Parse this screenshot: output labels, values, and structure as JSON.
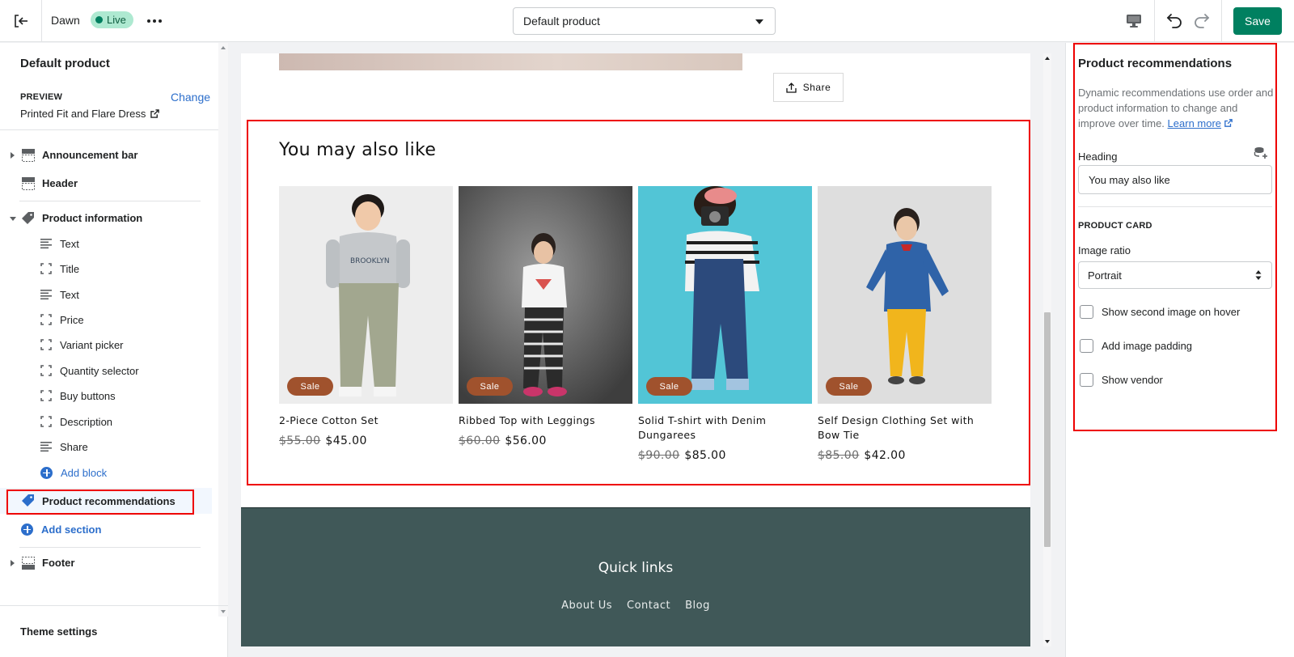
{
  "topbar": {
    "theme_name": "Dawn",
    "live_badge": "Live",
    "template_select": "Default product",
    "save_label": "Save"
  },
  "sidebar": {
    "title": "Default product",
    "preview_label": "PREVIEW",
    "change_link": "Change",
    "preview_product": "Printed Fit and Flare Dress",
    "sections_top": [
      {
        "label": "Announcement bar",
        "icon": "section-icon"
      },
      {
        "label": "Header",
        "icon": "section-icon"
      }
    ],
    "product_information": {
      "label": "Product information",
      "icon": "tag-icon",
      "blocks": [
        {
          "label": "Text",
          "icon": "text-lines-icon"
        },
        {
          "label": "Title",
          "icon": "block-corners-icon"
        },
        {
          "label": "Text",
          "icon": "text-lines-icon"
        },
        {
          "label": "Price",
          "icon": "block-corners-icon"
        },
        {
          "label": "Variant picker",
          "icon": "block-corners-icon"
        },
        {
          "label": "Quantity selector",
          "icon": "block-corners-icon"
        },
        {
          "label": "Buy buttons",
          "icon": "block-corners-icon"
        },
        {
          "label": "Description",
          "icon": "block-corners-icon"
        },
        {
          "label": "Share",
          "icon": "text-lines-icon"
        }
      ],
      "add_block": "Add block"
    },
    "product_recommendations": "Product recommendations",
    "add_section": "Add section",
    "footer": "Footer",
    "theme_settings": "Theme settings"
  },
  "preview": {
    "share_label": "Share",
    "heading": "You may also like",
    "products": [
      {
        "title": "2-Piece Cotton Set",
        "old_price": "$55.00",
        "price": "$45.00",
        "badge": "Sale"
      },
      {
        "title": "Ribbed Top with Leggings",
        "old_price": "$60.00",
        "price": "$56.00",
        "badge": "Sale"
      },
      {
        "title": "Solid T-shirt with Denim Dungarees",
        "old_price": "$90.00",
        "price": "$85.00",
        "badge": "Sale"
      },
      {
        "title": "Self Design Clothing Set with Bow Tie",
        "old_price": "$85.00",
        "price": "$42.00",
        "badge": "Sale"
      }
    ],
    "footer_heading": "Quick links",
    "footer_links": [
      "About Us",
      "Contact",
      "Blog"
    ]
  },
  "settings": {
    "title": "Product recommendations",
    "description": "Dynamic recommendations use order and product information to change and improve over time.",
    "learn_more": "Learn more",
    "heading_label": "Heading",
    "heading_value": "You may also like",
    "product_card_label": "PRODUCT CARD",
    "image_ratio_label": "Image ratio",
    "image_ratio_value": "Portrait",
    "checkboxes": [
      {
        "label": "Show second image on hover",
        "checked": false
      },
      {
        "label": "Add image padding",
        "checked": false
      },
      {
        "label": "Show vendor",
        "checked": false
      }
    ]
  },
  "colors": {
    "accent": "#008060",
    "link": "#2c6ecb",
    "sale_badge": "#a0522d",
    "footer_bg": "#405858",
    "highlight": "#ee0000"
  }
}
